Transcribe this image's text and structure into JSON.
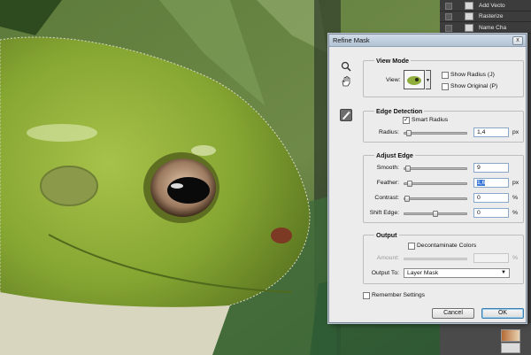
{
  "colors": {
    "photo_bg": "#4d6a3a",
    "frog_green": "#8fae3b",
    "dialog_bg": "#ececec",
    "titlebar": "#c4d3e2",
    "selection": "#3b78d8"
  },
  "panel": {
    "rows": [
      "Add Vecto",
      "Rasterize",
      "Name Cha"
    ]
  },
  "dialog": {
    "title": "Refine Mask",
    "close_label": "x",
    "tools": [
      "zoom-tool-icon",
      "hand-tool-icon",
      "refine-radius-tool-icon"
    ],
    "view_mode": {
      "title": "View Mode",
      "view_label": "View:",
      "show_radius_label": "Show Radius (J)",
      "show_radius_checked": false,
      "show_original_label": "Show Original (P)",
      "show_original_checked": false
    },
    "edge_detection": {
      "title": "Edge Detection",
      "smart_radius_label": "Smart Radius",
      "smart_radius_checked": true,
      "radius_label": "Radius:",
      "radius_value": "1,4",
      "radius_unit": "px",
      "radius_slider": 0.03
    },
    "adjust_edge": {
      "title": "Adjust Edge",
      "smooth_label": "Smooth:",
      "smooth_value": "9",
      "smooth_unit": "",
      "smooth_slider": 0.02,
      "feather_label": "Feather:",
      "feather_value": "1,6",
      "feather_unit": "px",
      "feather_slider": 0.05,
      "contrast_label": "Contrast:",
      "contrast_value": "0",
      "contrast_unit": "%",
      "contrast_slider": 0,
      "shift_label": "Shift Edge:",
      "shift_value": "0",
      "shift_unit": "%",
      "shift_slider": 0.5
    },
    "output": {
      "title": "Output",
      "decontaminate_label": "Decontaminate Colors",
      "decontaminate_checked": false,
      "amount_label": "Amount:",
      "amount_unit": "%",
      "output_to_label": "Output To:",
      "output_to_value": "Layer Mask"
    },
    "remember_label": "Remember Settings",
    "remember_checked": false,
    "cancel_label": "Cancel",
    "ok_label": "OK"
  }
}
